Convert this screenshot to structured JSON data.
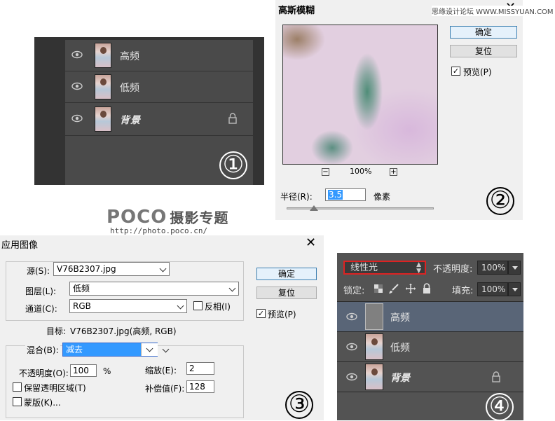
{
  "site_watermark": "思缘设计论坛 WWW.MISSYUAN.COM",
  "watermark": {
    "logo": "POCO",
    "logo_cn": "摄影专题",
    "url": "http://photo.poco.cn/"
  },
  "panel1": {
    "layers": [
      {
        "name": "高频",
        "locked": false
      },
      {
        "name": "低频",
        "locked": false
      },
      {
        "name": "背景",
        "locked": true
      }
    ],
    "step": "①"
  },
  "panel2": {
    "title": "高斯模糊",
    "ok": "确定",
    "reset": "复位",
    "preview_label": "预览(P)",
    "preview_checked": true,
    "zoom": "100%",
    "zoom_out": "−",
    "zoom_in": "+",
    "radius_label": "半径(R):",
    "radius_value": "3.5",
    "radius_unit": "像素",
    "step": "②"
  },
  "panel3": {
    "title": "应用图像",
    "source_label": "源(S):",
    "source_value": "V76B2307.jpg",
    "layer_label": "图层(L):",
    "layer_value": "低频",
    "channel_label": "通道(C):",
    "channel_value": "RGB",
    "invert_label": "反相(I)",
    "target_label": "目标:",
    "target_value": "V76B2307.jpg(高频, RGB)",
    "blend_label": "混合(B):",
    "blend_value": "减去",
    "opacity_label": "不透明度(O):",
    "opacity_value": "100",
    "opacity_unit": "%",
    "scale_label": "缩放(E):",
    "scale_value": "2",
    "offset_label": "补偿值(F):",
    "offset_value": "128",
    "preserve_label": "保留透明区域(T)",
    "mask_label": "蒙版(K)...",
    "ok": "确定",
    "reset": "复位",
    "preview_label": "预览(P)",
    "preview_checked": true,
    "step": "③"
  },
  "panel4": {
    "blend_mode": "线性光",
    "opacity_label": "不透明度:",
    "opacity_value": "100%",
    "lock_label": "锁定:",
    "fill_label": "填充:",
    "fill_value": "100%",
    "layers": [
      {
        "name": "高频",
        "selected": true,
        "gray": true
      },
      {
        "name": "低频",
        "selected": false,
        "gray": false
      },
      {
        "name": "背景",
        "selected": false,
        "gray": false,
        "locked": true
      }
    ],
    "step": "④"
  }
}
